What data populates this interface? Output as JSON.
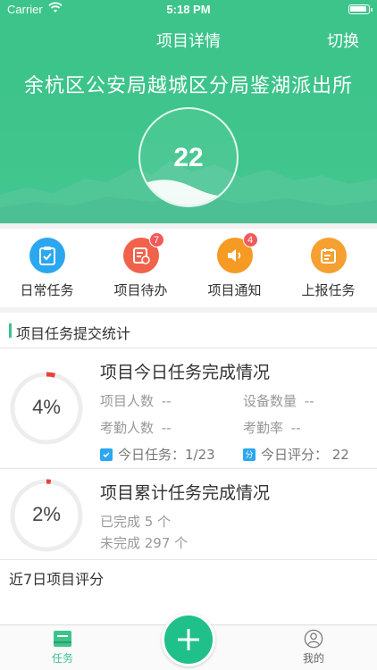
{
  "status_bar": {
    "carrier": "Carrier",
    "time": "5:18 PM"
  },
  "nav": {
    "title": "项目详情",
    "switch_label": "切换"
  },
  "hero": {
    "organization": "余杭区公安局越城区分局鉴湖派出所",
    "score": "22"
  },
  "quick_actions": [
    {
      "label": "日常任务",
      "icon": "clipboard-check-icon",
      "color": "#2aa7f0",
      "badge": ""
    },
    {
      "label": "项目待办",
      "icon": "todo-list-icon",
      "color": "#f0624a",
      "badge": "7"
    },
    {
      "label": "项目通知",
      "icon": "speaker-icon",
      "color": "#f59a23",
      "badge": "4"
    },
    {
      "label": "上报任务",
      "icon": "report-icon",
      "color": "#f5a030",
      "badge": ""
    }
  ],
  "section_title": "项目任务提交统计",
  "today_card": {
    "title": "项目今日任务完成情况",
    "percent_label": "4%",
    "percent": 0.04,
    "people_key": "项目人数",
    "people_value": "--",
    "devices_key": "设备数量",
    "devices_value": "--",
    "attendance_key": "考勤人数",
    "attendance_value": "--",
    "attendance_rate_key": "考勤率",
    "attendance_rate_value": "--",
    "today_tasks": "今日任务：1/23",
    "today_score": "今日评分：  22"
  },
  "total_card": {
    "title": "项目累计任务完成情况",
    "percent_label": "2%",
    "percent": 0.02,
    "done": "已完成 5 个",
    "undone": "未完成 297 个"
  },
  "week_title": "近7日项目评分",
  "tabs": [
    {
      "label": "任务",
      "icon": "task-book-icon",
      "active": true
    },
    {
      "label": "我的",
      "icon": "user-icon",
      "active": false
    }
  ],
  "colors": {
    "brand": "#3cc48a",
    "ring_track": "#ededed",
    "ring_progress": "#e8403a"
  }
}
